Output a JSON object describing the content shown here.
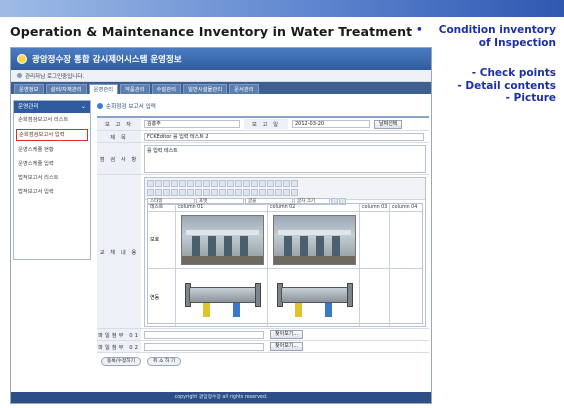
{
  "slide": {
    "title": "Operation & Maintenance Inventory in Water Treatment",
    "bullet": "•",
    "notes_top": [
      "Condition inventory",
      "of Inspection"
    ],
    "notes_list": [
      "- Check points",
      "- Detail contents",
      "- Picture"
    ]
  },
  "app": {
    "title": "광암정수장 통합 감시제어시스템 운영정보",
    "user_line": "관리자님 로그인중입니다.",
    "menu": [
      "운영정보",
      "설비/자재관리",
      "운영관리",
      "약품관리",
      "수질관리",
      "일반시설물관리",
      "문서관리"
    ],
    "active_menu_index": 2
  },
  "sidebar": {
    "header": "운영관리",
    "items": [
      "순회점검보고서 리스트",
      "순회점검보고서 입력",
      "운영스케쥴 현황",
      "운영스케쥴 입력",
      "법적보고서 리스트",
      "법적보고서 입력"
    ],
    "selected_index": 1
  },
  "form": {
    "crumb": "순회점검 보고서 입력",
    "labels": {
      "reporter": "보 고 자",
      "subject": "제 목",
      "items": "점 검 사 항",
      "contents": "교 체 내 용",
      "file1": "파일첨부 01",
      "file2": "파일첨부 02",
      "date": "보 고 일"
    },
    "reporter_value": "김홍주",
    "date_value": "2012-03-20",
    "date_button": "날짜선택",
    "subject_value": "FCKEditor 를 입력 테스트 2",
    "items_value": "를 입력 테스트",
    "toolbar_selects": [
      "스타일",
      "포맷",
      "글꼴",
      "글자 크기"
    ],
    "grid_headers": [
      "테스트",
      "column 01",
      "column 02",
      "column 03",
      "column 04"
    ],
    "grid_rows": [
      "보호",
      "연동"
    ],
    "browse_button": "찾아보기...",
    "bottom_buttons": [
      "등록/수정하기",
      "취 소 하 기"
    ]
  },
  "footer": {
    "copyright": "copyright 광암정수장 all rights reserved."
  }
}
